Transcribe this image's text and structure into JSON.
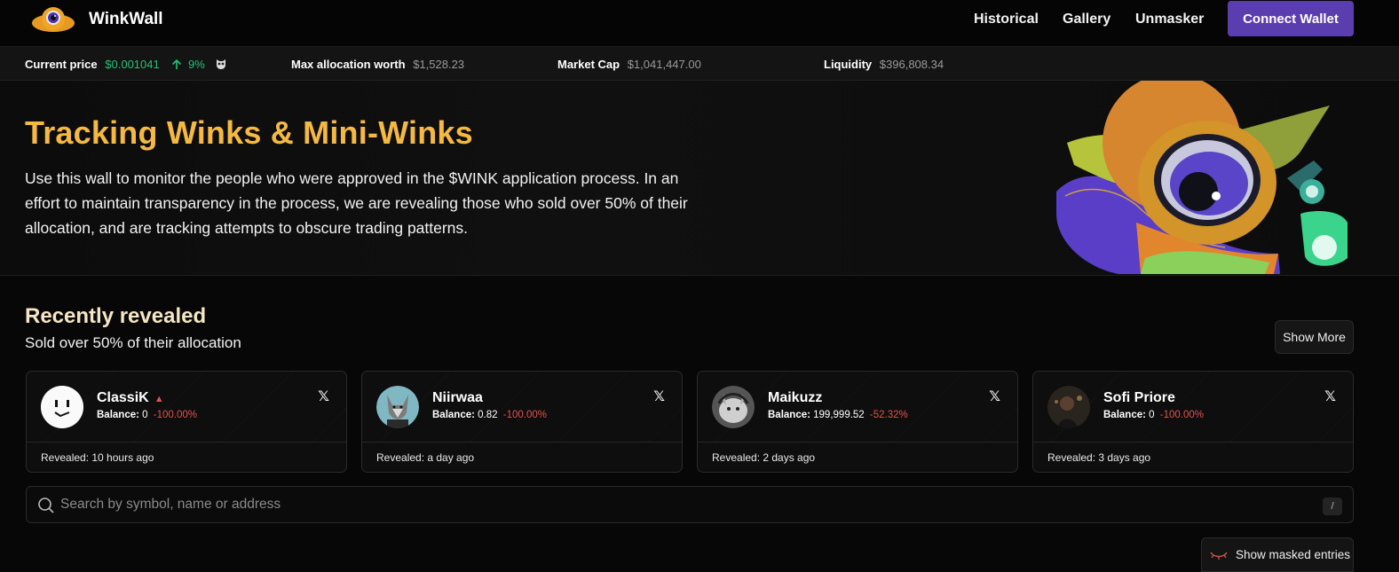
{
  "nav": {
    "brand": "WinkWall",
    "links": [
      "Historical",
      "Gallery",
      "Unmasker"
    ],
    "connect_label": "Connect Wallet"
  },
  "ticker": {
    "current_price_label": "Current price",
    "current_price_value": "$0.001041",
    "change": "9%",
    "max_alloc_label": "Max allocation worth",
    "max_alloc_value": "$1,528.23",
    "market_cap_label": "Market Cap",
    "market_cap_value": "$1,041,447.00",
    "liquidity_label": "Liquidity",
    "liquidity_value": "$396,808.34"
  },
  "hero": {
    "title": "Tracking Winks & Mini-Winks",
    "description": "Use this wall to monitor the people who were approved in the $WINK application process. In an effort to maintain transparency in the process, we are revealing those who sold over 50% of their allocation, and are tracking attempts to obscure trading patterns."
  },
  "recent": {
    "title": "Recently revealed",
    "subtitle": "Sold over 50% of their allocation",
    "show_more": "Show More",
    "cards": [
      {
        "name": "ClassiK",
        "flag": "▲",
        "balance_label": "Balance:",
        "balance": "0",
        "change": "-100.00%",
        "revealed": "Revealed: 10 hours ago",
        "x": "𝕏"
      },
      {
        "name": "Niirwaa",
        "flag": "",
        "balance_label": "Balance:",
        "balance": "0.82",
        "change": "-100.00%",
        "revealed": "Revealed: a day ago",
        "x": "𝕏"
      },
      {
        "name": "Maikuzz",
        "flag": "",
        "balance_label": "Balance:",
        "balance": "199,999.52",
        "change": "-52.32%",
        "revealed": "Revealed: 2 days ago",
        "x": "𝕏"
      },
      {
        "name": "Sofi Priore",
        "flag": "",
        "balance_label": "Balance:",
        "balance": "0",
        "change": "-100.00%",
        "revealed": "Revealed: 3 days ago",
        "x": "𝕏"
      }
    ]
  },
  "search": {
    "placeholder": "Search by symbol, name or address",
    "shortcut": "/"
  },
  "masked": {
    "label": "Show masked entries"
  },
  "colors": {
    "accent": "#5a3eb0",
    "title": "#f5b942",
    "green": "#22c17a",
    "red": "#e0534f"
  }
}
